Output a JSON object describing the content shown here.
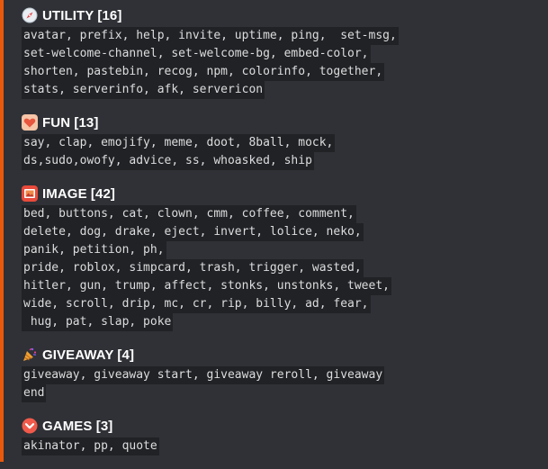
{
  "accent_color": "#e8590c",
  "background_color": "#2f3136",
  "code_background": "#202225",
  "sections": [
    {
      "icon": "compass-icon",
      "title": "UTILITY [16]",
      "lines": [
        "avatar, prefix, help, invite, uptime, ping,  set-msg,",
        "set-welcome-channel, set-welcome-bg, embed-color,",
        "shorten, pastebin, recog, npm, colorinfo, together,",
        "stats, serverinfo, afk, servericon"
      ]
    },
    {
      "icon": "heart-icon",
      "title": "FUN [13]",
      "lines": [
        "say, clap, emojify, meme, doot, 8ball, mock,",
        "ds,sudo,owofy, advice, ss, whoasked, ship"
      ]
    },
    {
      "icon": "image-frame-icon",
      "title": "IMAGE [42]",
      "lines": [
        "bed, buttons, cat, clown, cmm, coffee, comment,",
        "delete, dog, drake, eject, invert, lolice, neko,",
        "panik, petition, ph,",
        "pride, roblox, simpcard, trash, trigger, wasted,",
        "hitler, gun, trump, affect, stonks, unstonks, tweet,",
        "wide, scroll, drip, mc, cr, rip, billy, ad, fear,",
        " hug, pat, slap, poke"
      ]
    },
    {
      "icon": "party-popper-icon",
      "title": "GIVEAWAY [4]",
      "lines": [
        "giveaway, giveaway start, giveaway reroll, giveaway",
        "end"
      ]
    },
    {
      "icon": "chevron-down-circle-icon",
      "title": "GAMES [3]",
      "lines": [
        "akinator, pp, quote"
      ]
    }
  ]
}
